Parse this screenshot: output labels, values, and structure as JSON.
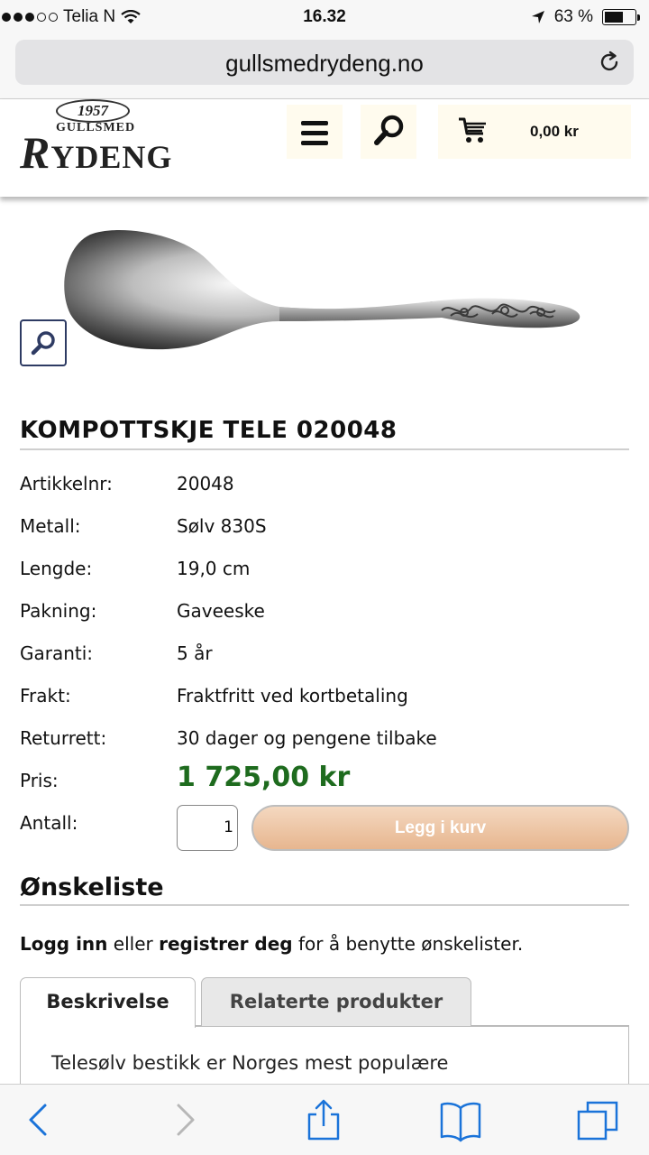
{
  "status_bar": {
    "carrier": "Telia N",
    "time": "16.32",
    "battery_percent": "63 %",
    "battery_level": 0.63
  },
  "browser": {
    "url": "gullsmedrydeng.no"
  },
  "site_header": {
    "logo_year": "1957",
    "logo_top": "GULLSMED",
    "logo_name_initial": "R",
    "logo_name_rest": "YDENG",
    "cart_total": "0,00 kr"
  },
  "product": {
    "title": "KOMPOTTSKJE TELE 020048",
    "specs": [
      {
        "label": "Artikkelnr:",
        "value": "20048"
      },
      {
        "label": "Metall:",
        "value": "Sølv 830S"
      },
      {
        "label": "Lengde:",
        "value": "19,0 cm"
      },
      {
        "label": "Pakning:",
        "value": "Gaveeske"
      },
      {
        "label": "Garanti:",
        "value": "5 år"
      },
      {
        "label": "Frakt:",
        "value": "Fraktfritt ved kortbetaling"
      },
      {
        "label": "Returrett:",
        "value": "30 dager og pengene tilbake"
      }
    ],
    "price_label": "Pris:",
    "price": "1 725,00 kr",
    "quantity_label": "Antall:",
    "quantity_value": "1",
    "add_to_cart_label": "Legg i kurv"
  },
  "wishlist": {
    "heading": "Ønskeliste",
    "login_link": "Logg inn",
    "or_text": " eller ",
    "register_link": "registrer deg",
    "suffix_text": " for å benytte ønskelister."
  },
  "tabs": {
    "items": [
      {
        "label": "Beskrivelse",
        "active": true
      },
      {
        "label": "Relaterte produkter",
        "active": false
      }
    ],
    "content_preview": "Telesølv bestikk er Norges mest populære"
  },
  "colors": {
    "price_green": "#1e6b1e",
    "cart_bg": "#fffbee",
    "add_button": "#e7b68f",
    "zoom_border": "#2e3b63",
    "ios_blue": "#1a73d9"
  }
}
